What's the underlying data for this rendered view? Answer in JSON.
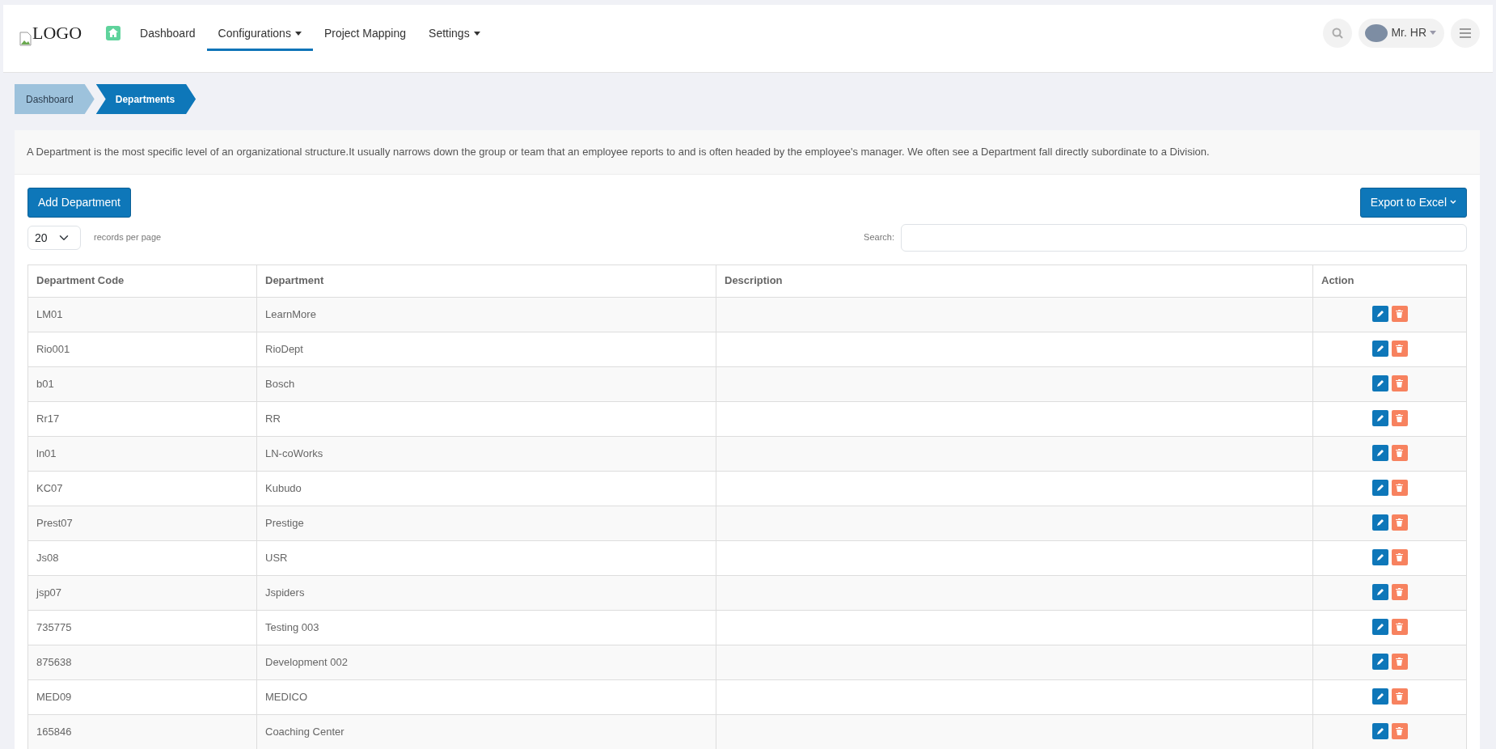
{
  "nav": {
    "logo_text": "LOGO",
    "items": [
      {
        "label": "Dashboard",
        "selected": false,
        "dropdown": false
      },
      {
        "label": "Configurations",
        "selected": true,
        "dropdown": true
      },
      {
        "label": "Project Mapping",
        "selected": false,
        "dropdown": false
      },
      {
        "label": "Settings",
        "selected": false,
        "dropdown": true
      }
    ],
    "user": {
      "name": "Mr. HR"
    }
  },
  "breadcrumb": [
    {
      "label": "Dashboard",
      "selected": false
    },
    {
      "label": "Departments",
      "selected": true
    }
  ],
  "description": "A Department is the most specific level of an organizational structure.It usually narrows down the group or team that an employee reports to and is often headed by the employee's manager. We often see a Department fall directly subordinate to a Division.",
  "add_button": "Add Department",
  "export_button": "Export to Excel",
  "page_length": "20",
  "length_label": "records per page",
  "search_label": "Search:",
  "table": {
    "columns": [
      "Department Code",
      "Department",
      "Description",
      "Action"
    ],
    "rows": [
      {
        "code": "LM01",
        "department": "LearnMore"
      },
      {
        "code": "Rio001",
        "department": "RioDept"
      },
      {
        "code": "b01",
        "department": "Bosch"
      },
      {
        "code": "Rr17",
        "department": "RR"
      },
      {
        "code": "ln01",
        "department": "LN-coWorks"
      },
      {
        "code": "KC07",
        "department": "Kubudo"
      },
      {
        "code": "Prest07",
        "department": "Prestige"
      },
      {
        "code": "Js08",
        "department": "USR"
      },
      {
        "code": "jsp07",
        "department": "Jspiders"
      },
      {
        "code": "735775",
        "department": "Testing 003"
      },
      {
        "code": "875638",
        "department": "Development 002"
      },
      {
        "code": "MED09",
        "department": "MEDICO"
      },
      {
        "code": "165846",
        "department": "Coaching Center"
      }
    ]
  }
}
